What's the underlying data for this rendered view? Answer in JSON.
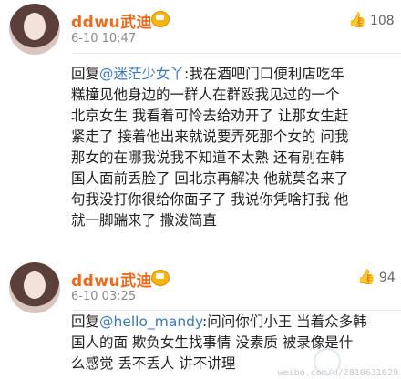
{
  "posts": [
    {
      "username": "ddwu武迪",
      "time": "6-10 10:47",
      "likes": "108",
      "lines": [
        [
          "回复",
          "@迷茫少女丫",
          ":我在酒吧门口便利店吃年"
        ],
        [
          "",
          "",
          "糕撞见他身边的一群人在群殴我见过的一个"
        ],
        [
          "",
          "",
          "北京女生 我看着可怜去给劝开了 让那女生赶"
        ],
        [
          "",
          "",
          "紧走了 接着他出来就说要弄死那个女的 问我"
        ],
        [
          "",
          "",
          "那女的在哪我说我不知道不太熟 还有别在韩"
        ],
        [
          "",
          "",
          "国人面前丢脸了 回北京再解决 他就莫名来了"
        ],
        [
          "",
          "",
          "句我没打你很给你面子了 我说你凭啥打我 他"
        ],
        [
          "",
          "",
          "就一脚踹来了 撒泼简直"
        ]
      ]
    },
    {
      "username": "ddwu武迪",
      "time": "6-10 03:25",
      "likes": "94",
      "lines": [
        [
          "回复",
          "@hello_mandy",
          ":问问你们小王 当着众多韩"
        ],
        [
          "",
          "",
          "国人的面 欺负女生找事情 没素质 被录像是什"
        ],
        [
          "",
          "",
          "么感觉 丢不丢人 讲不讲理"
        ]
      ]
    }
  ],
  "watermark": "weibo.com/u/2810631029"
}
